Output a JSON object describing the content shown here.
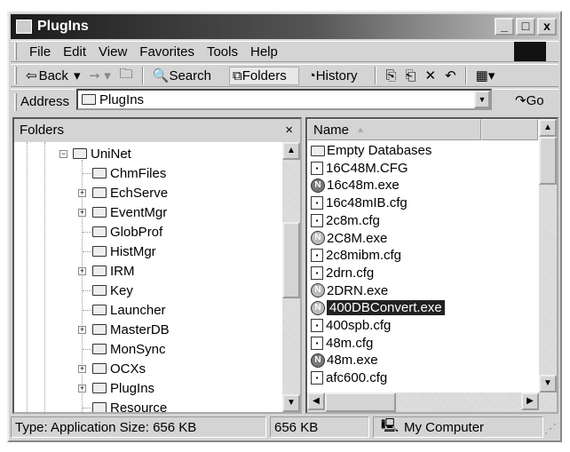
{
  "window": {
    "title": "PlugIns",
    "min": "_",
    "max": "□",
    "close": "x"
  },
  "menu": [
    "File",
    "Edit",
    "View",
    "Favorites",
    "Tools",
    "Help"
  ],
  "toolbar": {
    "back": "Back",
    "search": "Search",
    "folders": "Folders",
    "history": "History"
  },
  "address": {
    "label": "Address",
    "value": "PlugIns",
    "go": "Go"
  },
  "folders": {
    "title": "Folders",
    "close": "×",
    "root": "UniNet",
    "items": [
      {
        "label": "ChmFiles",
        "expandable": false
      },
      {
        "label": "EchServe",
        "expandable": true
      },
      {
        "label": "EventMgr",
        "expandable": true
      },
      {
        "label": "GlobProf",
        "expandable": false
      },
      {
        "label": "HistMgr",
        "expandable": false
      },
      {
        "label": "IRM",
        "expandable": true
      },
      {
        "label": "Key",
        "expandable": false
      },
      {
        "label": "Launcher",
        "expandable": false
      },
      {
        "label": "MasterDB",
        "expandable": true
      },
      {
        "label": "MonSync",
        "expandable": false
      },
      {
        "label": "OCXs",
        "expandable": true
      },
      {
        "label": "PlugIns",
        "expandable": true
      },
      {
        "label": "Resource",
        "expandable": false
      }
    ]
  },
  "files": {
    "column": "Name",
    "items": [
      {
        "name": "Empty Databases",
        "type": "folder"
      },
      {
        "name": "16C48M.CFG",
        "type": "cfg"
      },
      {
        "name": "16c48m.exe",
        "type": "exe"
      },
      {
        "name": "16c48mIB.cfg",
        "type": "cfg"
      },
      {
        "name": "2c8m.cfg",
        "type": "cfg"
      },
      {
        "name": "2C8M.exe",
        "type": "exe-light"
      },
      {
        "name": "2c8mibm.cfg",
        "type": "cfg"
      },
      {
        "name": "2drn.cfg",
        "type": "cfg"
      },
      {
        "name": "2DRN.exe",
        "type": "exe-light"
      },
      {
        "name": "400DBConvert.exe",
        "type": "exe-light",
        "selected": true
      },
      {
        "name": "400spb.cfg",
        "type": "cfg"
      },
      {
        "name": "48m.cfg",
        "type": "cfg"
      },
      {
        "name": "48m.exe",
        "type": "exe"
      },
      {
        "name": "afc600.cfg",
        "type": "cfg"
      }
    ]
  },
  "status": {
    "info": "Type: Application Size: 656 KB",
    "size": "656 KB",
    "zone": "My Computer"
  }
}
